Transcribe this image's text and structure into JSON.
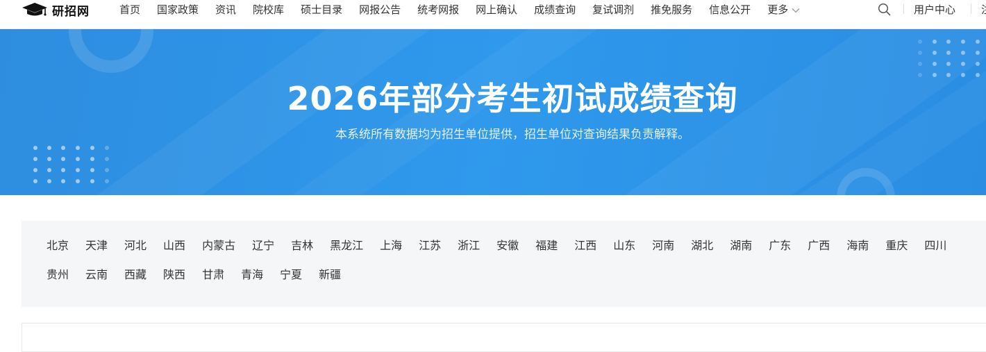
{
  "nav": {
    "logo_text": "研招网",
    "items": [
      "首页",
      "国家政策",
      "资讯",
      "院校库",
      "硕士目录",
      "网报公告",
      "统考网报",
      "网上确认",
      "成绩查询",
      "复试调剂",
      "推免服务",
      "信息公开"
    ],
    "more_label": "更多",
    "user_center": "用户中心",
    "cut_link": "注"
  },
  "banner": {
    "title": "2026年部分考生初试成绩查询",
    "subtitle": "本系统所有数据均为招生单位提供，招生单位对查询结果负责解释。"
  },
  "provinces": [
    "北京",
    "天津",
    "河北",
    "山西",
    "内蒙古",
    "辽宁",
    "吉林",
    "黑龙江",
    "上海",
    "江苏",
    "浙江",
    "安徽",
    "福建",
    "江西",
    "山东",
    "河南",
    "湖北",
    "湖南",
    "广东",
    "广西",
    "海南",
    "重庆",
    "四川",
    "贵州",
    "云南",
    "西藏",
    "陕西",
    "甘肃",
    "青海",
    "宁夏",
    "新疆"
  ],
  "colors": {
    "banner_blue": "#2f95e9",
    "panel_bg": "#f5f6f8",
    "nav_text": "#333333"
  },
  "icons": [
    "graduation-cap-icon",
    "chevron-down-icon",
    "search-icon"
  ]
}
